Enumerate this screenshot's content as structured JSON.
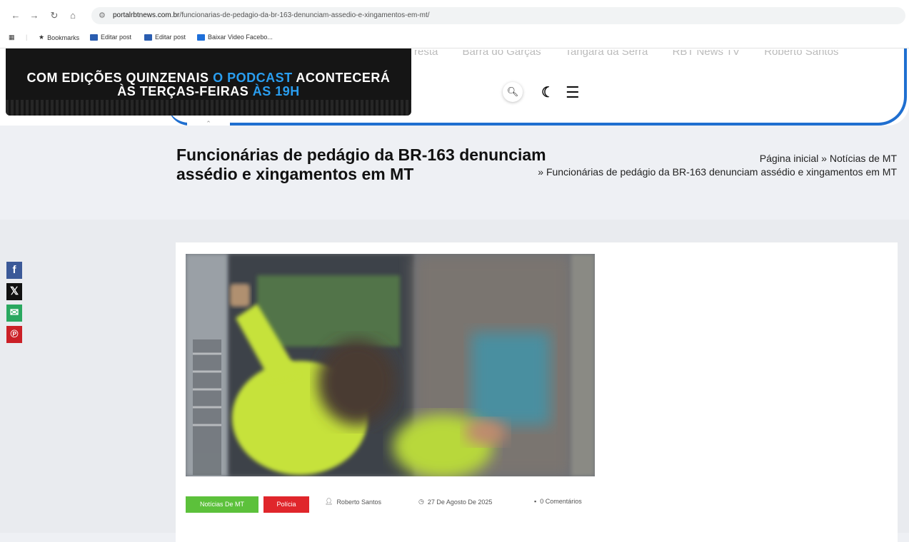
{
  "browser": {
    "url_host": "portalrbtnews.com.br",
    "url_path": "/funcionarias-de-pedagio-da-br-163-denunciam-assedio-e-xingamentos-em-mt/",
    "bookmarks": [
      {
        "label": "Bookmarks",
        "icon": "star-icon",
        "color": "#333333"
      },
      {
        "label": "Editar post",
        "icon": "blog-icon",
        "color": "#2a5db0"
      },
      {
        "label": "Editar post",
        "icon": "blog-icon",
        "color": "#2a5db0"
      },
      {
        "label": "Baixar Video Facebo...",
        "icon": "download-icon",
        "color": "#1e6fd9"
      }
    ]
  },
  "site": {
    "nav_partial": [
      "resta",
      "Barra do Garças",
      "Tangará da Serra",
      "RBT News TV",
      "Roberto Santos"
    ],
    "promo_line1_a": "COM EDIÇÕES QUINZENAIS ",
    "promo_line1_b": "O PODCAST",
    "promo_line1_c": " ACONTECERÁ",
    "promo_line2_a": "ÀS TERÇAS-FEIRAS ",
    "promo_line2_b": "ÀS 19H",
    "accent": "#1f6fd0"
  },
  "page": {
    "title": "Funcionárias de pedágio da BR-163 denunciam assédio e xingamentos em MT",
    "breadcrumb_home": "Página inicial",
    "breadcrumb_category": "Notícias de MT",
    "breadcrumb_current": "Funcionárias de pedágio da BR-163 denunciam assédio e xingamentos em MT"
  },
  "social": [
    {
      "icon": "facebook-icon",
      "glyph": "f",
      "color": "#3b5998"
    },
    {
      "icon": "x-icon",
      "glyph": "𝕏",
      "color": "#111111"
    },
    {
      "icon": "email-icon",
      "glyph": "✉",
      "color": "#2aa860"
    },
    {
      "icon": "pinterest-icon",
      "glyph": "℗",
      "color": "#cb2027"
    }
  ],
  "post": {
    "tag1": "Notícias De MT",
    "tag1_color": "#5cc13b",
    "tag2": "Polícia",
    "tag2_color": "#e0262b",
    "author": "Roberto Santos",
    "date": "27 De Agosto De 2025",
    "comments": "0 Comentários"
  }
}
